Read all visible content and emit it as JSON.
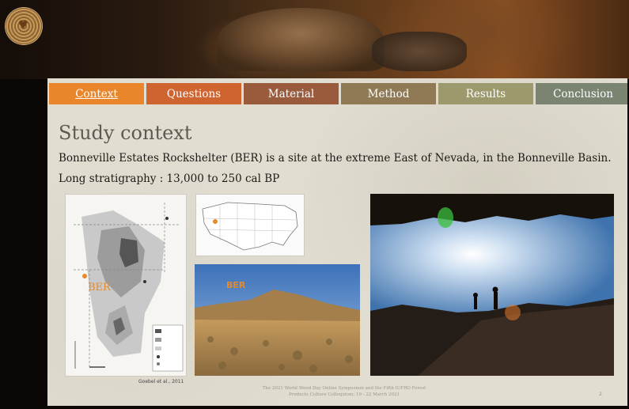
{
  "tabs": [
    {
      "label": "Context",
      "color": "#e9862b"
    },
    {
      "label": "Questions",
      "color": "#cf6430"
    },
    {
      "label": "Method",
      "color": "#8f7a55"
    },
    {
      "label": "Results",
      "color": "#9c9a6d"
    },
    {
      "label": "Conclusion",
      "color": "#7b8470"
    }
  ],
  "tab_material": {
    "label": "Material",
    "color": "#9a5a3c"
  },
  "slide": {
    "title": "Study context",
    "line1": "Bonneville Estates Rockshelter (BER) is a site at the extreme East of Nevada, in the Bonneville Basin.",
    "line2": "Long stratigraphy : 13,000 to 250 cal BP",
    "map_label": "BER",
    "map_credit": "Goebel et al., 2011",
    "photo_label": "BER",
    "footer_line1": "The 2021 World Wood Day Online Symposium and the Fifth IUFRO Forest",
    "footer_line2": "Products Culture Colloquium; 19 - 22 March 2021",
    "page_number": "2"
  },
  "logo": {
    "glyph": "♥"
  }
}
